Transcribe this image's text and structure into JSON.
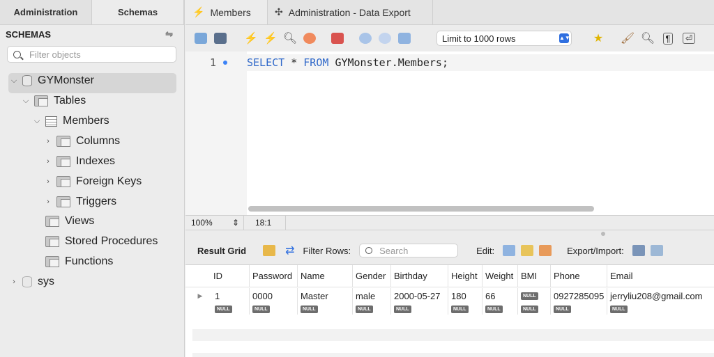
{
  "left_panel": {
    "tabs": [
      "Administration",
      "Schemas"
    ],
    "header": "SCHEMAS",
    "filter_placeholder": "Filter objects",
    "tree": {
      "schema": "GYMonster",
      "tables": "Tables",
      "table": "Members",
      "columns": "Columns",
      "indexes": "Indexes",
      "foreign_keys": "Foreign Keys",
      "triggers": "Triggers",
      "views": "Views",
      "stored_procedures": "Stored Procedures",
      "functions": "Functions",
      "sys": "sys"
    }
  },
  "tabs": [
    "Members",
    "Administration - Data Export"
  ],
  "toolbar": {
    "limit": "Limit to 1000 rows"
  },
  "editor": {
    "line_number": "1",
    "kw_select": "SELECT",
    "star": "*",
    "kw_from": "FROM",
    "target": "GYMonster.Members;",
    "zoom": "100%",
    "cursor_pos": "18:1"
  },
  "result": {
    "title": "Result Grid",
    "filter_label": "Filter Rows:",
    "search_placeholder": "Search",
    "edit_label": "Edit:",
    "export_label": "Export/Import:",
    "columns": [
      "ID",
      "Password",
      "Name",
      "Gender",
      "Birthday",
      "Height",
      "Weight",
      "BMI",
      "Phone",
      "Email"
    ],
    "row": [
      "1",
      "0000",
      "Master",
      "male",
      "2000-05-27",
      "180",
      "66",
      "NULL",
      "0927285095",
      "jerryliu208@gmail.com"
    ],
    "null_label": "NULL"
  },
  "colors": {
    "keyword": "#2f68c9",
    "accent": "#2f6fe0"
  }
}
